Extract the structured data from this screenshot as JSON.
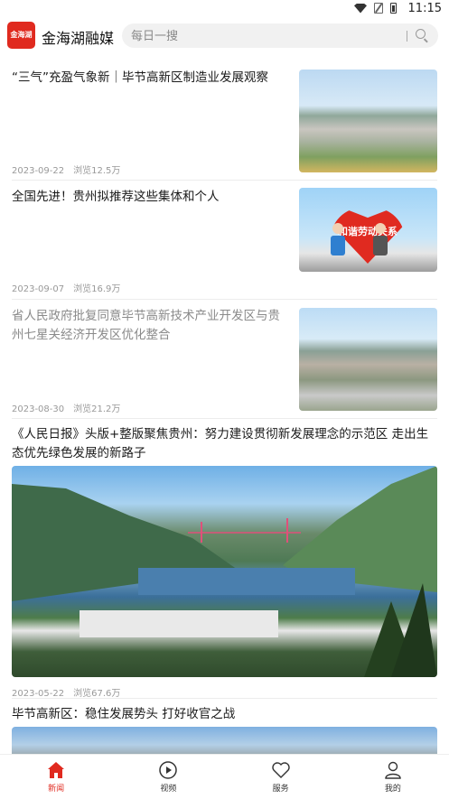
{
  "status_bar": {
    "time": "11:15"
  },
  "header": {
    "logo_text": "金海湖",
    "app_name": "金海湖融媒",
    "search_placeholder": "每日一搜"
  },
  "feed": [
    {
      "title": "“三气”充盈气象新｜毕节高新区制造业发展观察",
      "date": "2023-09-22",
      "views": "浏览12.5万",
      "read": false,
      "image": "factory-aerial"
    },
    {
      "title": "全国先进！贵州拟推荐这些集体和个人",
      "date": "2023-09-07",
      "views": "浏览16.9万",
      "read": false,
      "image": "labor-relations-illustration",
      "image_text": "和谐劳动关系"
    },
    {
      "title": "省人民政府批复同意毕节高新技术产业开发区与贵州七星关经济开发区优化整合",
      "date": "2023-08-30",
      "views": "浏览21.2万",
      "read": true,
      "image": "industrial-park-aerial"
    },
    {
      "title": "《人民日报》头版+整版聚焦贵州：努力建设贯彻新发展理念的示范区 走出生态优先绿色发展的新路子",
      "date": "2023-05-22",
      "views": "浏览67.6万",
      "read": false,
      "image": "river-valley-village"
    },
    {
      "title": "毕节高新区：稳住发展势头 打好收官之战",
      "image": "city-aerial"
    }
  ],
  "tabbar": [
    {
      "label": "新闻",
      "icon": "home-icon",
      "active": true
    },
    {
      "label": "视频",
      "icon": "play-icon",
      "active": false
    },
    {
      "label": "服务",
      "icon": "heart-icon",
      "active": false
    },
    {
      "label": "我的",
      "icon": "person-icon",
      "active": false
    }
  ],
  "colors": {
    "accent": "#e02a1f",
    "meta": "#999999",
    "read_title": "#8a8a8a"
  }
}
